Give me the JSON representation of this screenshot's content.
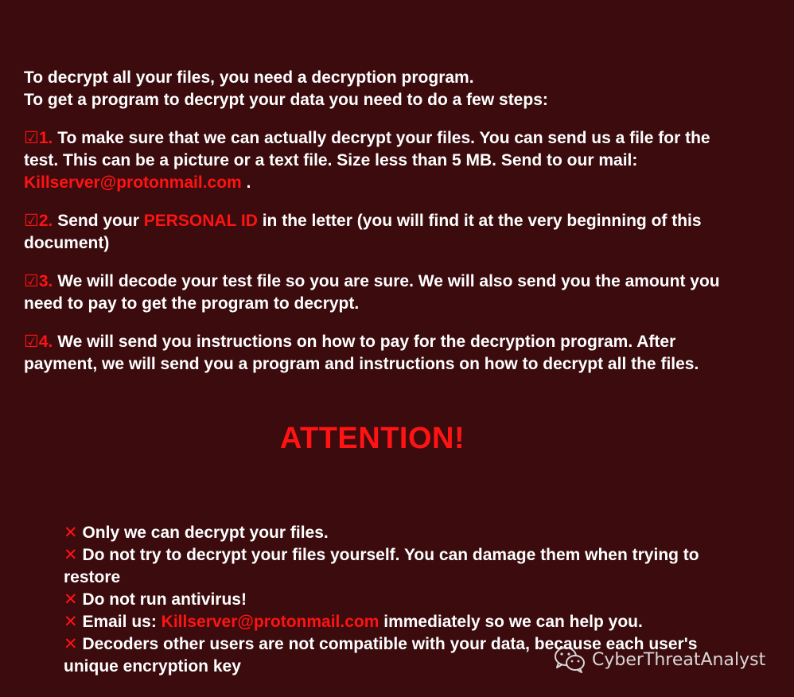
{
  "intro": {
    "line1": "To decrypt all your files, you need a decryption program.",
    "line2": "To get a program to decrypt your data you need to do a few steps:"
  },
  "steps": [
    {
      "number": "☑1.",
      "text_before": "To make sure that we can actually decrypt your files. You can send us a file for the test. This can be a picture or a text file. Size less than 5 MB. Send to our mail:",
      "highlight": "Killserver@protonmail.com",
      "text_after": "."
    },
    {
      "number": "☑2.",
      "text_before": "Send your",
      "highlight": "PERSONAL ID",
      "text_after": "in the letter (you will find it at the very beginning of this document)"
    },
    {
      "number": "☑3.",
      "text_before": "We will decode your test file so you are sure. We will also send you the amount you need to pay to get the program to decrypt.",
      "highlight": "",
      "text_after": ""
    },
    {
      "number": "☑4.",
      "text_before": "We will send you instructions on how to pay for the decryption program. After payment, we will send you a program and instructions on how to decrypt all the files.",
      "highlight": "",
      "text_after": ""
    }
  ],
  "attention": "ATTENTION!",
  "warnings": [
    {
      "mark": "✕",
      "text_before": "Only we can decrypt your files.",
      "highlight": "",
      "text_after": ""
    },
    {
      "mark": "✕",
      "text_before": "Do not try to decrypt your files yourself. You can damage them when trying to restore",
      "highlight": "",
      "text_after": ""
    },
    {
      "mark": "✕",
      "text_before": "Do not run antivirus!",
      "highlight": "",
      "text_after": ""
    },
    {
      "mark": "✕",
      "text_before": "Email us:",
      "highlight": "Killserver@protonmail.com",
      "text_after": "immediately so we can help you."
    },
    {
      "mark": "✕",
      "text_before": "Decoders other users are not compatible with your data, because each user's unique encryption key",
      "highlight": "",
      "text_after": ""
    }
  ],
  "watermark": {
    "text": "CyberThreatAnalyst",
    "icon": "wechat-icon"
  },
  "colors": {
    "background": "#3b0b0e",
    "text": "#ffffff",
    "accent": "#ff1313"
  }
}
